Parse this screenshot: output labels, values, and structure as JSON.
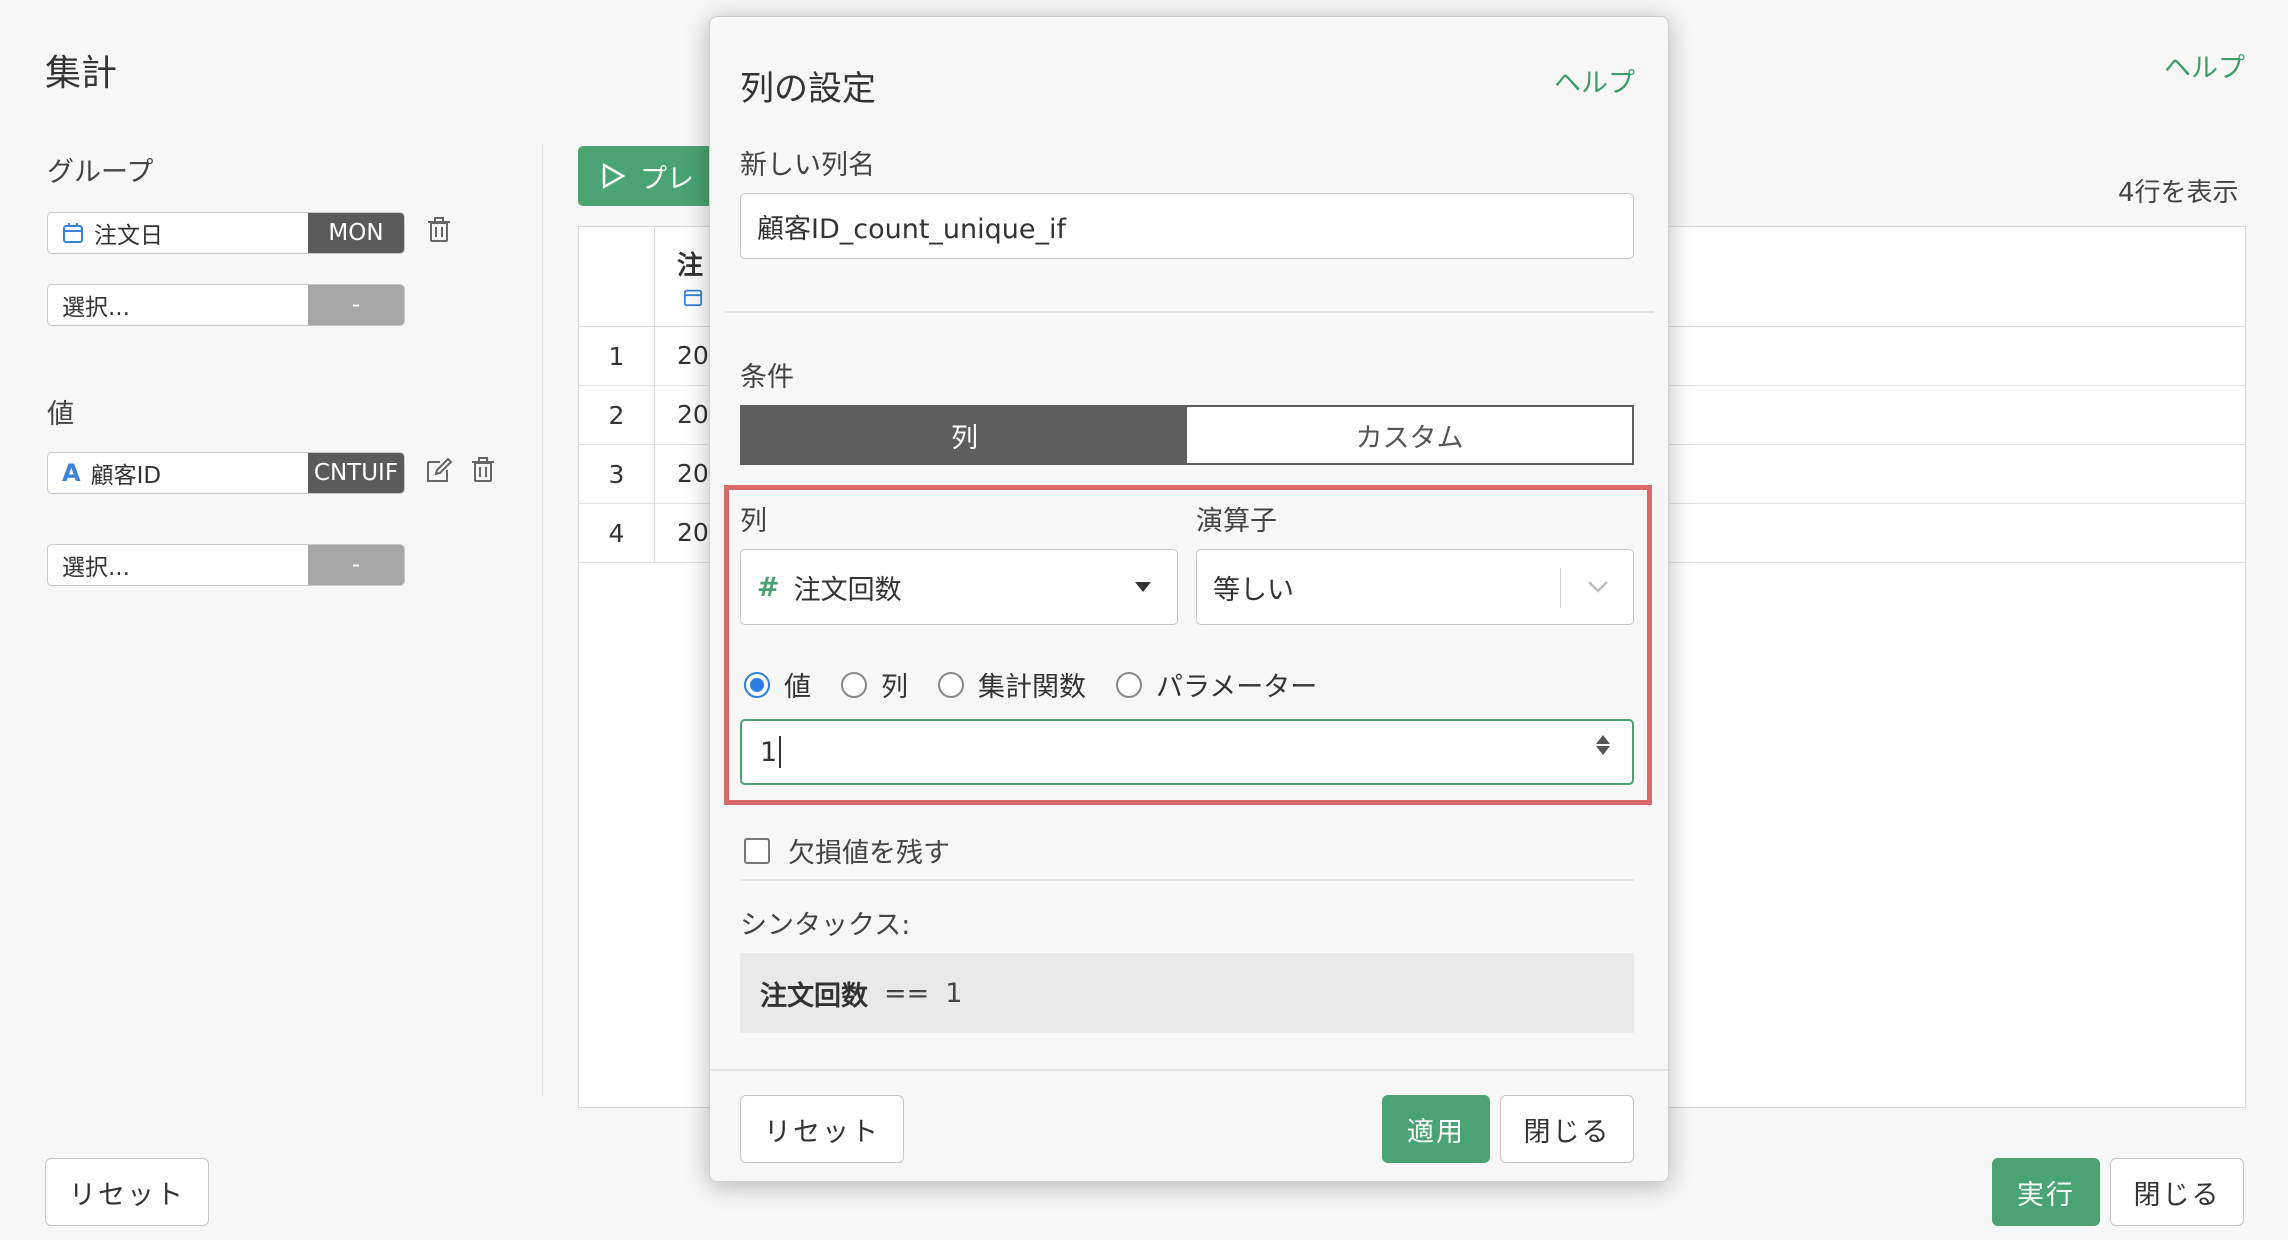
{
  "page": {
    "title": "集計",
    "help": "ヘルプ",
    "row_count": "4行を表示",
    "preview_label": "プレ"
  },
  "sidebar": {
    "group_label": "グループ",
    "group_field": {
      "name": "注文日",
      "tag": "MON",
      "icon": "calendar-icon"
    },
    "group_select": {
      "placeholder": "選択...",
      "tag": "-"
    },
    "value_label": "値",
    "value_field": {
      "name": "顧客ID",
      "tag": "CNTUIF",
      "icon": "text-type-icon"
    },
    "value_select": {
      "placeholder": "選択...",
      "tag": "-"
    }
  },
  "table": {
    "header": "注",
    "rows": [
      {
        "idx": "1",
        "val": "20"
      },
      {
        "idx": "2",
        "val": "20"
      },
      {
        "idx": "3",
        "val": "20"
      },
      {
        "idx": "4",
        "val": "20"
      }
    ]
  },
  "footer": {
    "reset": "リセット",
    "run": "実行",
    "close": "閉じる"
  },
  "modal": {
    "title": "列の設定",
    "help": "ヘルプ",
    "new_col_label": "新しい列名",
    "new_col_value": "顧客ID_count_unique_if",
    "condition_label": "条件",
    "tabs": [
      "列",
      "カスタム"
    ],
    "column_label": "列",
    "column_value": "注文回数",
    "operator_label": "演算子",
    "operator_value": "等しい",
    "radio_options": [
      "値",
      "列",
      "集計関数",
      "パラメーター"
    ],
    "value_input": "1",
    "keep_na_label": "欠損値を残す",
    "syntax_label": "シンタックス:",
    "syntax_col": "注文回数",
    "syntax_op": "==",
    "syntax_val": "1",
    "reset": "リセット",
    "apply": "適用",
    "close": "閉じる"
  },
  "colors": {
    "accent_green": "#4aa373",
    "highlight_red": "#d86a6a",
    "radio_blue": "#2d7ee0",
    "tag_dark": "#5a5a5a"
  }
}
